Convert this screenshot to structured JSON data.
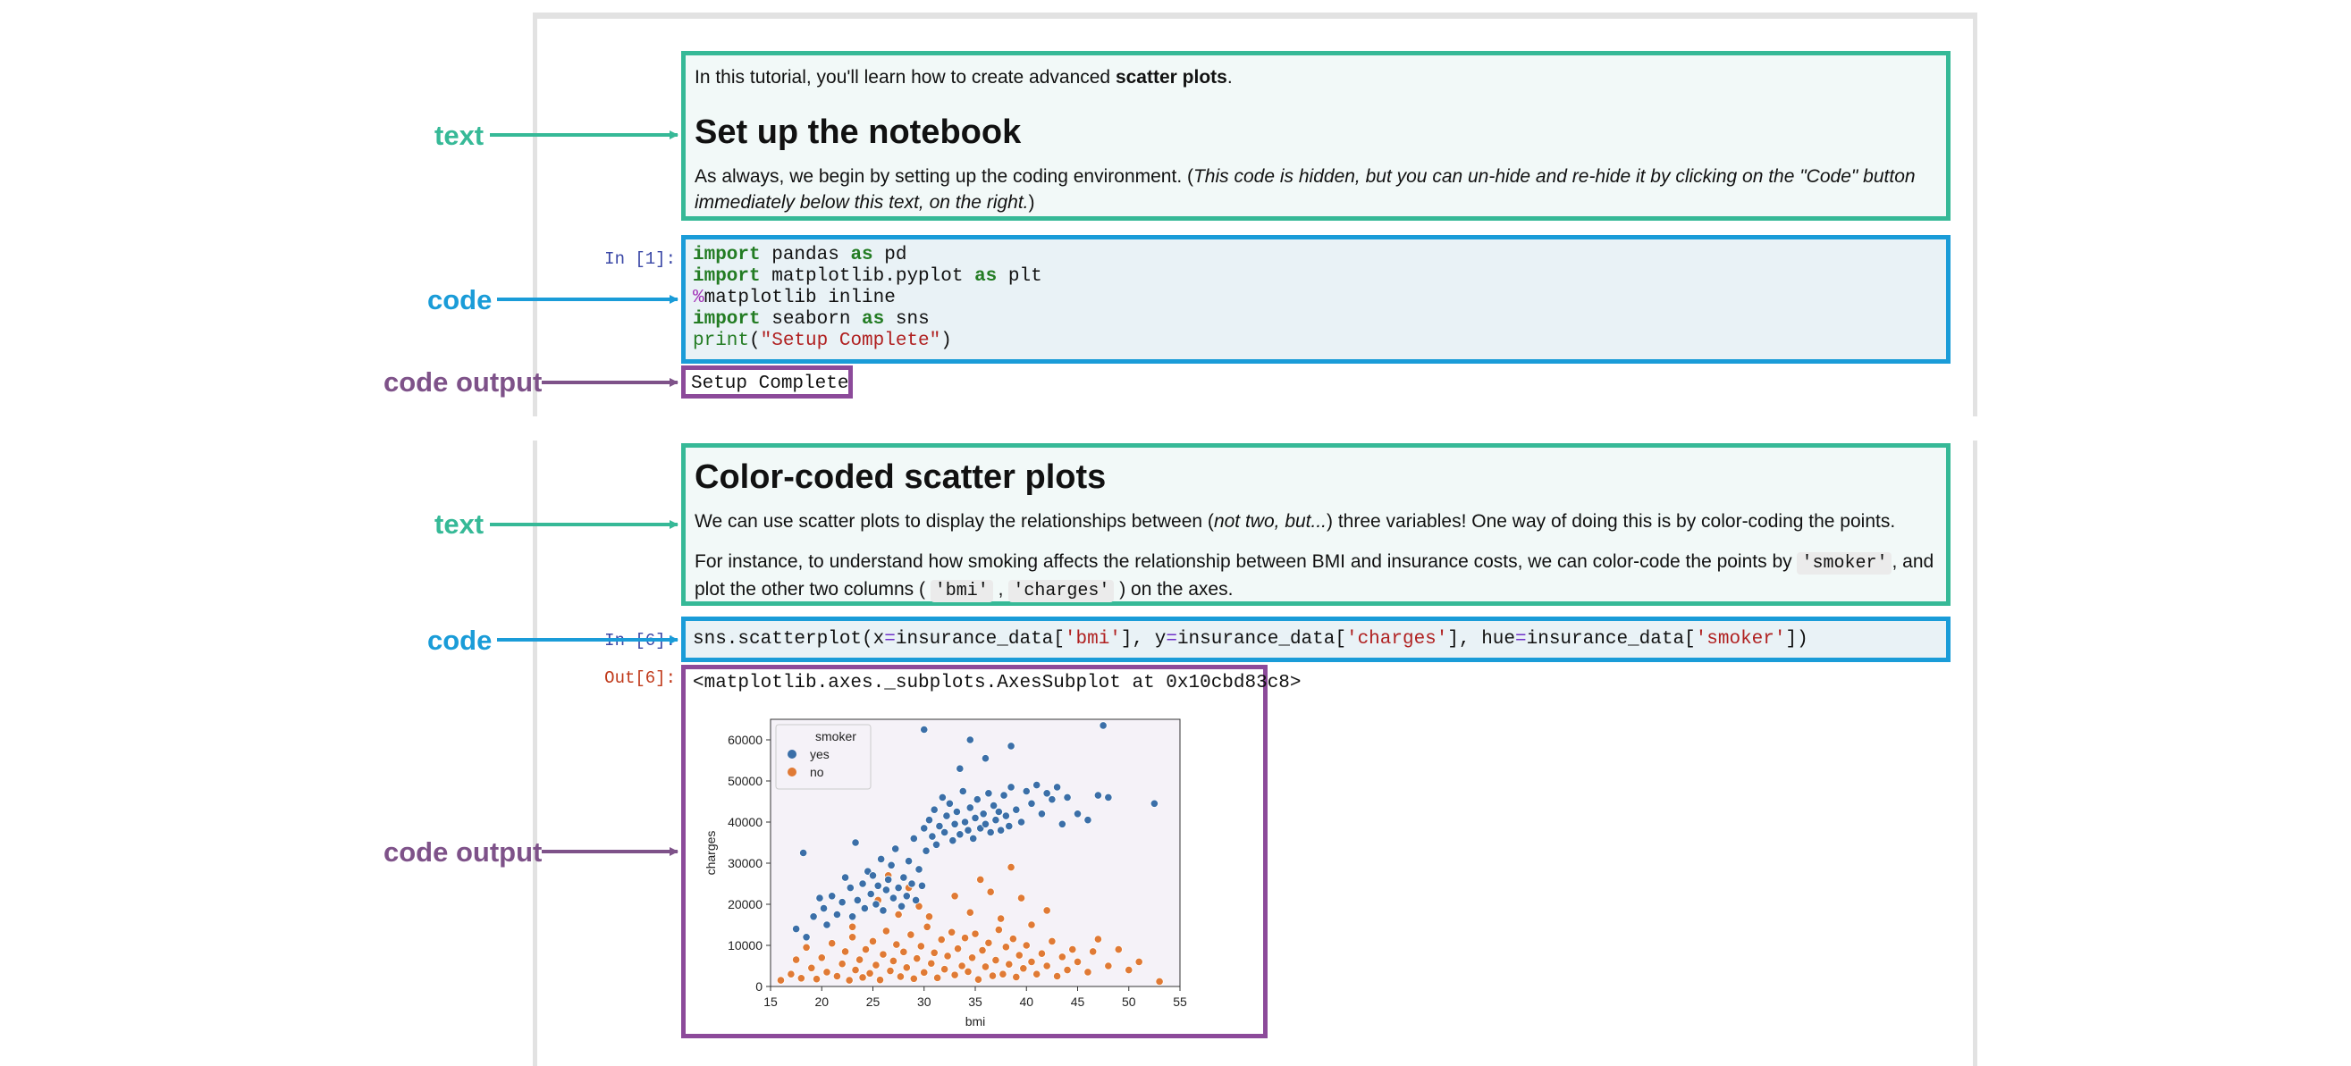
{
  "annotations": {
    "text1": "text",
    "code1": "code",
    "output1": "code output",
    "text2": "text",
    "code2": "code",
    "output2": "code output"
  },
  "colors": {
    "text_accent": "#36b997",
    "code_accent": "#1a9cd8",
    "output_accent": "#8c4a9a",
    "series_yes": "#3b6fa8",
    "series_no": "#e07a35"
  },
  "cell1": {
    "intro_prefix": "In this tutorial, you'll learn how to create advanced ",
    "intro_bold": "scatter plots",
    "intro_suffix": ".",
    "heading": "Set up the notebook",
    "para_plain": "As always, we begin by setting up the coding environment. (",
    "para_italic": "This code is hidden, but you can un-hide and re-hide it by clicking on the \"Code\" button immediately below this text, on the right.",
    "para_end": ")"
  },
  "cell2": {
    "prompt": "In [1]:",
    "line1": {
      "kw": "import",
      "rest1": " pandas ",
      "kw2": "as",
      "rest2": " pd"
    },
    "line2": {
      "kw": "import",
      "rest1": " matplotlib.pyplot ",
      "kw2": "as",
      "rest2": " plt"
    },
    "line3": {
      "magic": "%",
      "rest": "matplotlib inline"
    },
    "line4": {
      "kw": "import",
      "rest1": " seaborn ",
      "kw2": "as",
      "rest2": " sns"
    },
    "line5": {
      "fn": "print",
      "open": "(",
      "str": "\"Setup Complete\"",
      "close": ")"
    },
    "output": "Setup Complete"
  },
  "cell3": {
    "heading": "Color-coded scatter plots",
    "p1_a": "We can use scatter plots to display the relationships between (",
    "p1_italic": "not two, but...",
    "p1_b": ") three variables! One way of doing this is by color-coding the points.",
    "p2_a": "For instance, to understand how smoking affects the relationship between BMI and insurance costs, we can color-code the points by ",
    "p2_chip1": "'smoker'",
    "p2_b": ", and plot the other two columns ( ",
    "p2_chip2": "'bmi'",
    "p2_c": " , ",
    "p2_chip3": "'charges'",
    "p2_d": " ) on the axes."
  },
  "cell4": {
    "prompt": "In [6]:",
    "code": {
      "a": "sns.scatterplot(x",
      "eq": "=",
      "b": "insurance_data[",
      "s1": "'bmi'",
      "c": "], y",
      "d": "insurance_data[",
      "s2": "'charges'",
      "e": "], hue",
      "f": "insurance_data[",
      "s3": "'smoker'",
      "g": "])"
    },
    "out_prompt": "Out[6]:",
    "out_text": "<matplotlib.axes._subplots.AxesSubplot at 0x10cbd83c8>"
  },
  "chart_data": {
    "type": "scatter",
    "xlabel": "bmi",
    "ylabel": "charges",
    "xlim": [
      15,
      55
    ],
    "ylim": [
      0,
      65000
    ],
    "xticks": [
      15,
      20,
      25,
      30,
      35,
      40,
      45,
      50,
      55
    ],
    "yticks": [
      0,
      10000,
      20000,
      30000,
      40000,
      50000,
      60000
    ],
    "legend": {
      "title": "smoker",
      "position": "top-left"
    },
    "series": [
      {
        "name": "yes",
        "color": "#3b6fa8",
        "points": [
          [
            17.5,
            14000
          ],
          [
            18.2,
            32500
          ],
          [
            18.5,
            12000
          ],
          [
            19.2,
            17000
          ],
          [
            19.8,
            21500
          ],
          [
            20.2,
            19000
          ],
          [
            20.5,
            15000
          ],
          [
            21.0,
            22000
          ],
          [
            21.5,
            17500
          ],
          [
            22.0,
            20500
          ],
          [
            22.3,
            26500
          ],
          [
            22.8,
            24000
          ],
          [
            23.0,
            17000
          ],
          [
            23.3,
            35000
          ],
          [
            23.5,
            21000
          ],
          [
            24.0,
            25000
          ],
          [
            24.2,
            19000
          ],
          [
            24.5,
            28000
          ],
          [
            24.8,
            22500
          ],
          [
            25.0,
            27000
          ],
          [
            25.3,
            20000
          ],
          [
            25.5,
            24500
          ],
          [
            25.8,
            31000
          ],
          [
            26.0,
            18500
          ],
          [
            26.3,
            23500
          ],
          [
            26.5,
            26000
          ],
          [
            26.8,
            29500
          ],
          [
            27.0,
            21500
          ],
          [
            27.2,
            33500
          ],
          [
            27.5,
            24000
          ],
          [
            27.8,
            19500
          ],
          [
            28.0,
            26500
          ],
          [
            28.3,
            22000
          ],
          [
            28.5,
            30500
          ],
          [
            28.8,
            25000
          ],
          [
            29.0,
            36000
          ],
          [
            29.2,
            21000
          ],
          [
            29.5,
            28500
          ],
          [
            29.8,
            24500
          ],
          [
            30.0,
            38500
          ],
          [
            30.2,
            33000
          ],
          [
            30.5,
            40500
          ],
          [
            30.8,
            36500
          ],
          [
            31.0,
            43000
          ],
          [
            31.2,
            34500
          ],
          [
            31.5,
            39000
          ],
          [
            31.8,
            46000
          ],
          [
            32.0,
            37500
          ],
          [
            32.2,
            41500
          ],
          [
            32.5,
            44500
          ],
          [
            32.8,
            35500
          ],
          [
            33.0,
            39500
          ],
          [
            33.2,
            42500
          ],
          [
            33.5,
            37000
          ],
          [
            33.8,
            47500
          ],
          [
            34.0,
            40000
          ],
          [
            34.3,
            38000
          ],
          [
            34.5,
            43500
          ],
          [
            34.8,
            36000
          ],
          [
            35.0,
            41000
          ],
          [
            35.2,
            45500
          ],
          [
            35.5,
            38500
          ],
          [
            35.8,
            42000
          ],
          [
            36.0,
            39500
          ],
          [
            36.3,
            47000
          ],
          [
            36.5,
            37500
          ],
          [
            36.8,
            44000
          ],
          [
            37.0,
            40500
          ],
          [
            37.3,
            42500
          ],
          [
            37.5,
            38000
          ],
          [
            37.8,
            46500
          ],
          [
            38.0,
            41500
          ],
          [
            38.3,
            39000
          ],
          [
            38.5,
            48500
          ],
          [
            39.0,
            43000
          ],
          [
            39.5,
            40000
          ],
          [
            40.0,
            47500
          ],
          [
            40.5,
            44500
          ],
          [
            41.0,
            49000
          ],
          [
            41.5,
            42000
          ],
          [
            42.0,
            47000
          ],
          [
            42.5,
            45500
          ],
          [
            43.0,
            48500
          ],
          [
            43.5,
            39500
          ],
          [
            44.0,
            46000
          ],
          [
            45.0,
            42000
          ],
          [
            46.0,
            40500
          ],
          [
            47.0,
            46500
          ],
          [
            48.0,
            46000
          ],
          [
            30.0,
            62500
          ],
          [
            33.5,
            53000
          ],
          [
            34.5,
            60000
          ],
          [
            36.0,
            55500
          ],
          [
            38.5,
            58500
          ],
          [
            47.5,
            63500
          ],
          [
            52.5,
            44500
          ]
        ]
      },
      {
        "name": "no",
        "color": "#e07a35",
        "points": [
          [
            16.0,
            1500
          ],
          [
            17.0,
            3000
          ],
          [
            17.5,
            6500
          ],
          [
            18.0,
            2000
          ],
          [
            18.5,
            9500
          ],
          [
            19.0,
            4500
          ],
          [
            19.5,
            1800
          ],
          [
            20.0,
            7000
          ],
          [
            20.5,
            3500
          ],
          [
            21.0,
            10500
          ],
          [
            21.5,
            2500
          ],
          [
            22.0,
            5500
          ],
          [
            22.3,
            8500
          ],
          [
            22.7,
            1500
          ],
          [
            23.0,
            12000
          ],
          [
            23.3,
            4000
          ],
          [
            23.7,
            6500
          ],
          [
            24.0,
            2200
          ],
          [
            24.3,
            9000
          ],
          [
            24.7,
            3200
          ],
          [
            25.0,
            11000
          ],
          [
            25.3,
            5200
          ],
          [
            25.7,
            1600
          ],
          [
            26.0,
            7800
          ],
          [
            26.3,
            13500
          ],
          [
            26.7,
            3800
          ],
          [
            27.0,
            6200
          ],
          [
            27.3,
            10200
          ],
          [
            27.7,
            2400
          ],
          [
            28.0,
            8400
          ],
          [
            28.3,
            4600
          ],
          [
            28.7,
            12600
          ],
          [
            29.0,
            1900
          ],
          [
            29.3,
            6800
          ],
          [
            29.7,
            9800
          ],
          [
            30.0,
            3400
          ],
          [
            30.3,
            14500
          ],
          [
            30.7,
            5600
          ],
          [
            31.0,
            8200
          ],
          [
            31.3,
            2100
          ],
          [
            31.7,
            11400
          ],
          [
            32.0,
            4200
          ],
          [
            32.3,
            7400
          ],
          [
            32.7,
            13200
          ],
          [
            33.0,
            2800
          ],
          [
            33.3,
            9200
          ],
          [
            33.7,
            5000
          ],
          [
            34.0,
            11800
          ],
          [
            34.3,
            3600
          ],
          [
            34.7,
            7000
          ],
          [
            35.0,
            12800
          ],
          [
            35.3,
            1700
          ],
          [
            35.7,
            8800
          ],
          [
            36.0,
            4800
          ],
          [
            36.3,
            10600
          ],
          [
            36.7,
            2600
          ],
          [
            37.0,
            6400
          ],
          [
            37.3,
            13800
          ],
          [
            37.7,
            3000
          ],
          [
            38.0,
            9600
          ],
          [
            38.3,
            5400
          ],
          [
            38.7,
            11600
          ],
          [
            39.0,
            2300
          ],
          [
            39.3,
            7600
          ],
          [
            39.7,
            4400
          ],
          [
            40.0,
            10000
          ],
          [
            40.5,
            6000
          ],
          [
            41.0,
            3000
          ],
          [
            41.5,
            8000
          ],
          [
            42.0,
            5000
          ],
          [
            42.5,
            11000
          ],
          [
            43.0,
            2500
          ],
          [
            43.5,
            7200
          ],
          [
            44.0,
            4000
          ],
          [
            44.5,
            9000
          ],
          [
            45.0,
            6000
          ],
          [
            46.0,
            3500
          ],
          [
            46.5,
            8500
          ],
          [
            47.0,
            11500
          ],
          [
            48.0,
            5000
          ],
          [
            49.0,
            9000
          ],
          [
            50.0,
            4000
          ],
          [
            51.0,
            6000
          ],
          [
            53.0,
            1200
          ],
          [
            25.5,
            21000
          ],
          [
            26.5,
            27000
          ],
          [
            27.5,
            17500
          ],
          [
            28.5,
            24000
          ],
          [
            29.5,
            19500
          ],
          [
            33.0,
            22000
          ],
          [
            34.5,
            18000
          ],
          [
            35.5,
            26000
          ],
          [
            36.5,
            23000
          ],
          [
            37.5,
            16500
          ],
          [
            38.5,
            29000
          ],
          [
            39.5,
            21500
          ],
          [
            40.5,
            15000
          ],
          [
            42.0,
            18500
          ],
          [
            23.0,
            14500
          ],
          [
            30.5,
            17000
          ]
        ]
      }
    ]
  }
}
